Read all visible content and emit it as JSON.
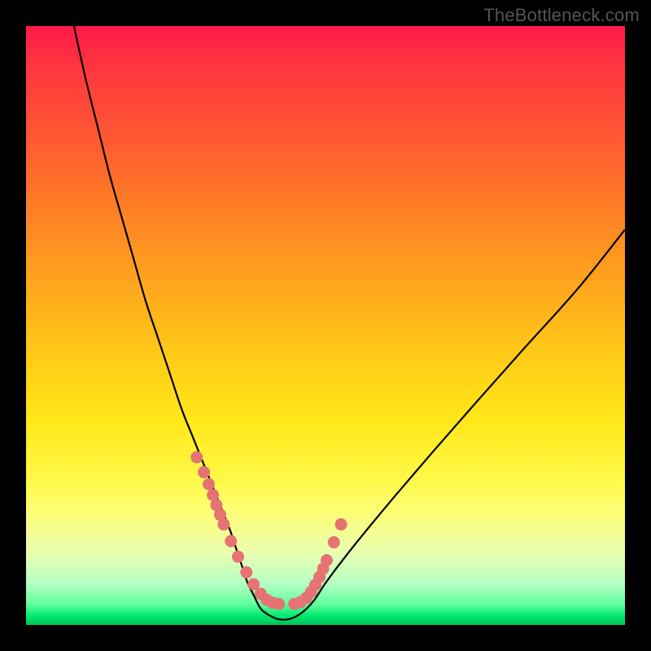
{
  "watermark": "TheBottleneck.com",
  "colors": {
    "curve_stroke": "#000000",
    "marker_fill": "#e57373",
    "marker_stroke": "#d85f5f"
  },
  "chart_data": {
    "type": "line",
    "title": "",
    "xlabel": "",
    "ylabel": "",
    "xlim": [
      0,
      100
    ],
    "ylim": [
      0,
      100
    ],
    "series": [
      {
        "name": "bottleneck-curve",
        "x": [
          8,
          10,
          12,
          14,
          16,
          18,
          20,
          22,
          24,
          26,
          28,
          30,
          32,
          34,
          35,
          36,
          37,
          38,
          39,
          40,
          42,
          44,
          46,
          48,
          50,
          53,
          57,
          62,
          68,
          75,
          83,
          92,
          100
        ],
        "values": [
          100,
          91,
          83,
          75,
          68,
          61,
          54,
          48,
          42,
          36,
          31,
          26,
          21,
          16,
          13,
          10,
          7,
          5,
          3,
          2,
          1,
          1,
          2,
          4,
          7,
          11,
          16,
          22,
          29,
          37,
          46,
          56,
          66
        ]
      }
    ],
    "markers": {
      "name": "highlight-dots",
      "x_percent": [
        28.5,
        29.7,
        30.5,
        31.2,
        31.8,
        32.4,
        33.0,
        34.2,
        35.4,
        36.8,
        38.0,
        39.2,
        40.2,
        41.2,
        42.2,
        44.8,
        45.8,
        46.8,
        47.6,
        48.3,
        49.0,
        49.6,
        50.2,
        51.4,
        52.6
      ],
      "y_percent": [
        72.0,
        74.5,
        76.5,
        78.3,
        80.0,
        81.6,
        83.2,
        86.0,
        88.6,
        91.2,
        93.2,
        94.8,
        95.8,
        96.3,
        96.5,
        96.5,
        96.2,
        95.5,
        94.5,
        93.3,
        92.0,
        90.6,
        89.2,
        86.2,
        83.2
      ]
    }
  }
}
